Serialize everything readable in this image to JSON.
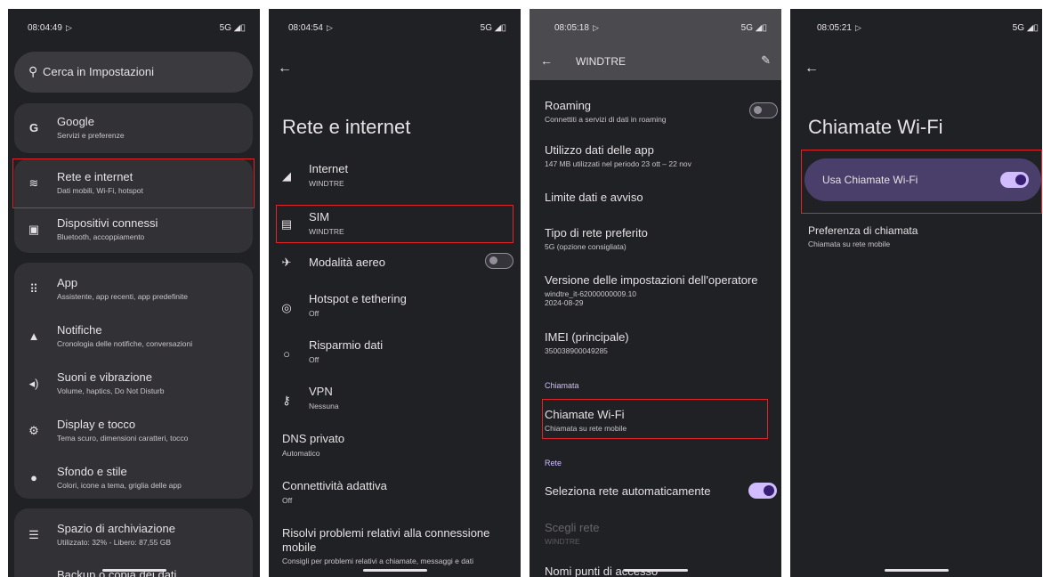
{
  "screen1": {
    "time": "08:04:49",
    "net": "5G",
    "search_placeholder": "Cerca in Impostazioni",
    "google": {
      "title": "Google",
      "subtitle": "Servizi e preferenze"
    },
    "items": [
      {
        "title": "Rete e internet",
        "subtitle": "Dati mobili, Wi-Fi, hotspot",
        "icon": "wifi-icon"
      },
      {
        "title": "Dispositivi connessi",
        "subtitle": "Bluetooth, accoppiamento",
        "icon": "devices-icon"
      },
      {
        "title": "App",
        "subtitle": "Assistente, app recenti, app predefinite",
        "icon": "apps-icon"
      },
      {
        "title": "Notifiche",
        "subtitle": "Cronologia delle notifiche, conversazioni",
        "icon": "bell-icon"
      },
      {
        "title": "Suoni e vibrazione",
        "subtitle": "Volume, haptics, Do Not Disturb",
        "icon": "volume-icon"
      },
      {
        "title": "Display e tocco",
        "subtitle": "Tema scuro, dimensioni caratteri, tocco",
        "icon": "brightness-icon"
      },
      {
        "title": "Sfondo e stile",
        "subtitle": "Colori, icone a tema, griglia delle app",
        "icon": "palette-icon"
      },
      {
        "title": "Spazio di archiviazione",
        "subtitle": "Utilizzato: 32% - Libero: 87,55 GB",
        "icon": "storage-icon"
      },
      {
        "title": "Backup o copia dei dati",
        "subtitle": "",
        "icon": "backup-icon"
      }
    ]
  },
  "screen2": {
    "time": "08:04:54",
    "net": "5G",
    "title": "Rete e internet",
    "rows": [
      {
        "title": "Internet",
        "subtitle": "WINDTRE",
        "icon": "signal-icon"
      },
      {
        "title": "SIM",
        "subtitle": "WINDTRE",
        "icon": "sim-icon"
      },
      {
        "title": "Modalità aereo",
        "subtitle": "",
        "icon": "airplane-icon"
      },
      {
        "title": "Hotspot e tethering",
        "subtitle": "Off",
        "icon": "hotspot-icon"
      },
      {
        "title": "Risparmio dati",
        "subtitle": "Off",
        "icon": "data-saver-icon"
      },
      {
        "title": "VPN",
        "subtitle": "Nessuna",
        "icon": "vpn-key-icon"
      },
      {
        "title": "DNS privato",
        "subtitle": "Automatico",
        "icon": ""
      },
      {
        "title": "Connettività adattiva",
        "subtitle": "Off",
        "icon": ""
      }
    ],
    "troubleshoot": {
      "title1": "Risolvi problemi relativi alla connessione",
      "title2": "mobile",
      "subtitle": "Consigli per problemi relativi a chiamate, messaggi e dati"
    }
  },
  "screen3": {
    "time": "08:05:18",
    "net": "5G",
    "appbar_title": "WINDTRE",
    "roaming": {
      "title": "Roaming",
      "subtitle": "Connettiti a servizi di dati in roaming"
    },
    "app_data": {
      "title": "Utilizzo dati delle app",
      "subtitle": "147 MB utilizzati nel periodo 23 ott – 22 nov"
    },
    "data_limit": {
      "title": "Limite dati e avviso"
    },
    "net_type": {
      "title": "Tipo di rete preferito",
      "subtitle": "5G (opzione consigliata)"
    },
    "carrier": {
      "title": "Versione delle impostazioni dell'operatore",
      "subtitle1": "windtre_it-62000000009.10",
      "subtitle2": "2024-08-29"
    },
    "imei": {
      "title": "IMEI (principale)",
      "subtitle": "350038900049285"
    },
    "section_call": "Chiamata",
    "wifi_call": {
      "title": "Chiamate Wi-Fi",
      "subtitle": "Chiamata su rete mobile"
    },
    "section_net": "Rete",
    "auto_net": {
      "title": "Seleziona rete automaticamente"
    },
    "choose_net": {
      "title": "Scegli rete",
      "subtitle": "WINDTRE"
    },
    "apn": {
      "title": "Nomi punti di accesso"
    }
  },
  "screen4": {
    "time": "08:05:21",
    "net": "5G",
    "title": "Chiamate Wi-Fi",
    "use_wifi": "Usa Chiamate Wi-Fi",
    "pref": {
      "title": "Preferenza di chiamata",
      "subtitle": "Chiamata su rete mobile"
    }
  },
  "colors": {
    "background": "#202124",
    "card": "#323236",
    "accent": "#d0bcff",
    "highlight": "#e0242a"
  }
}
